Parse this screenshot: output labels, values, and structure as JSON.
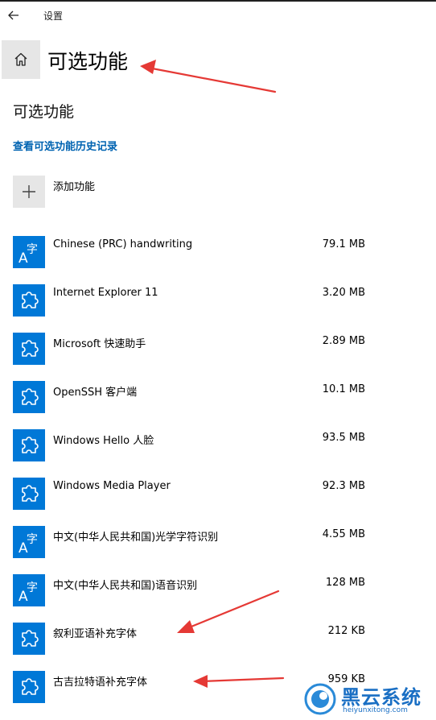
{
  "window": {
    "title": "设置"
  },
  "header": {
    "title": "可选功能"
  },
  "section": {
    "title": "可选功能"
  },
  "links": {
    "history": "查看可选功能历史记录"
  },
  "add_feature": {
    "label": "添加功能"
  },
  "colors": {
    "accent": "#0078d7",
    "link": "#0063b1",
    "annotation_arrow": "#e53935"
  },
  "features": [
    {
      "name": "Chinese (PRC) handwriting",
      "size": "79.1 MB",
      "icon": "language-icon"
    },
    {
      "name": "Internet Explorer 11",
      "size": "3.20 MB",
      "icon": "puzzle-icon"
    },
    {
      "name": "Microsoft 快速助手",
      "size": "2.89 MB",
      "icon": "puzzle-icon"
    },
    {
      "name": "OpenSSH 客户端",
      "size": "10.1 MB",
      "icon": "puzzle-icon"
    },
    {
      "name": "Windows Hello 人脸",
      "size": "93.5 MB",
      "icon": "puzzle-icon"
    },
    {
      "name": "Windows Media Player",
      "size": "92.3 MB",
      "icon": "puzzle-icon"
    },
    {
      "name": "中文(中华人民共和国)光学字符识别",
      "size": "4.55 MB",
      "icon": "language-icon"
    },
    {
      "name": "中文(中华人民共和国)语音识别",
      "size": "128 MB",
      "icon": "language-icon"
    },
    {
      "name": "叙利亚语补充字体",
      "size": "212 KB",
      "icon": "puzzle-icon"
    },
    {
      "name": "古吉拉特语补充字体",
      "size": "959 KB",
      "icon": "puzzle-icon"
    }
  ],
  "watermark": {
    "brand": "黑云系统",
    "url": "heiyunxitong.com"
  }
}
